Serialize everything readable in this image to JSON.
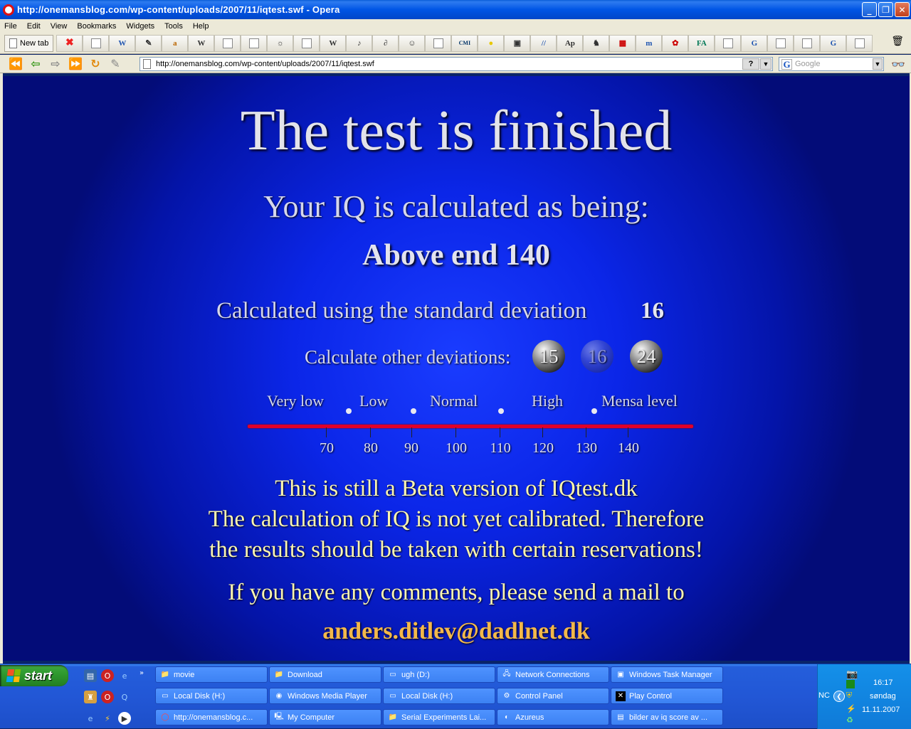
{
  "window": {
    "title": "http://onemansblog.com/wp-content/uploads/2007/11/iqtest.swf - Opera"
  },
  "menu": [
    "File",
    "Edit",
    "View",
    "Bookmarks",
    "Widgets",
    "Tools",
    "Help"
  ],
  "tabs": {
    "new_tab_label": "New tab"
  },
  "nav": {
    "url": "http://onemansblog.com/wp-content/uploads/2007/11/iqtest.swf",
    "help_btn": "?",
    "search_placeholder": "Google"
  },
  "content": {
    "headline": "The test is finished",
    "subhead": "Your IQ is calculated as being:",
    "score": "Above end 140",
    "stddev_label": "Calculated using the standard deviation",
    "stddev_value": "16",
    "other_label": "Calculate other deviations:",
    "deviations": [
      "15",
      "16",
      "24"
    ],
    "active_deviation": "16",
    "categories": [
      "Very low",
      "Low",
      "Normal",
      "High",
      "Mensa level"
    ],
    "ticks": [
      "70",
      "80",
      "90",
      "100",
      "110",
      "120",
      "130",
      "140"
    ],
    "beta_line1": "This is still a Beta version of IQtest.dk",
    "beta_line2": "The calculation of IQ is not yet calibrated. Therefore",
    "beta_line3": "the results should be taken with certain reservations!",
    "comments": "If you have any comments, please send a mail to",
    "email": "anders.ditlev@dadlnet.dk",
    "colors": {
      "scale_line": "#e0002a",
      "beta_text": "#fbf5b0",
      "email_text": "#f3b84a"
    }
  },
  "taskbar": {
    "start_label": "start",
    "buttons": [
      {
        "label": "movie",
        "icon": "folder-icon"
      },
      {
        "label": "Download",
        "icon": "folder-icon"
      },
      {
        "label": "ugh (D:)",
        "icon": "drive-icon"
      },
      {
        "label": "Network Connections",
        "icon": "network-icon"
      },
      {
        "label": "Windows Task Manager",
        "icon": "task-manager-icon"
      },
      {
        "label": "Local Disk (H:)",
        "icon": "drive-icon"
      },
      {
        "label": "Windows Media Player",
        "icon": "media-player-icon"
      },
      {
        "label": "Local Disk (H:)",
        "icon": "drive-icon"
      },
      {
        "label": "Control Panel",
        "icon": "control-panel-icon"
      },
      {
        "label": "Play Control",
        "icon": "play-control-icon"
      },
      {
        "label": "http://onemansblog.c...",
        "icon": "opera-icon"
      },
      {
        "label": "My Computer",
        "icon": "computer-icon"
      },
      {
        "label": "Serial Experiments Lai...",
        "icon": "folder-icon"
      },
      {
        "label": "Azureus",
        "icon": "azureus-icon"
      },
      {
        "label": "bilder av iq score av ...",
        "icon": "document-icon"
      }
    ],
    "tray": {
      "nc": "NC",
      "time": "16:17",
      "day": "søndag",
      "date": "11.11.2007"
    }
  }
}
